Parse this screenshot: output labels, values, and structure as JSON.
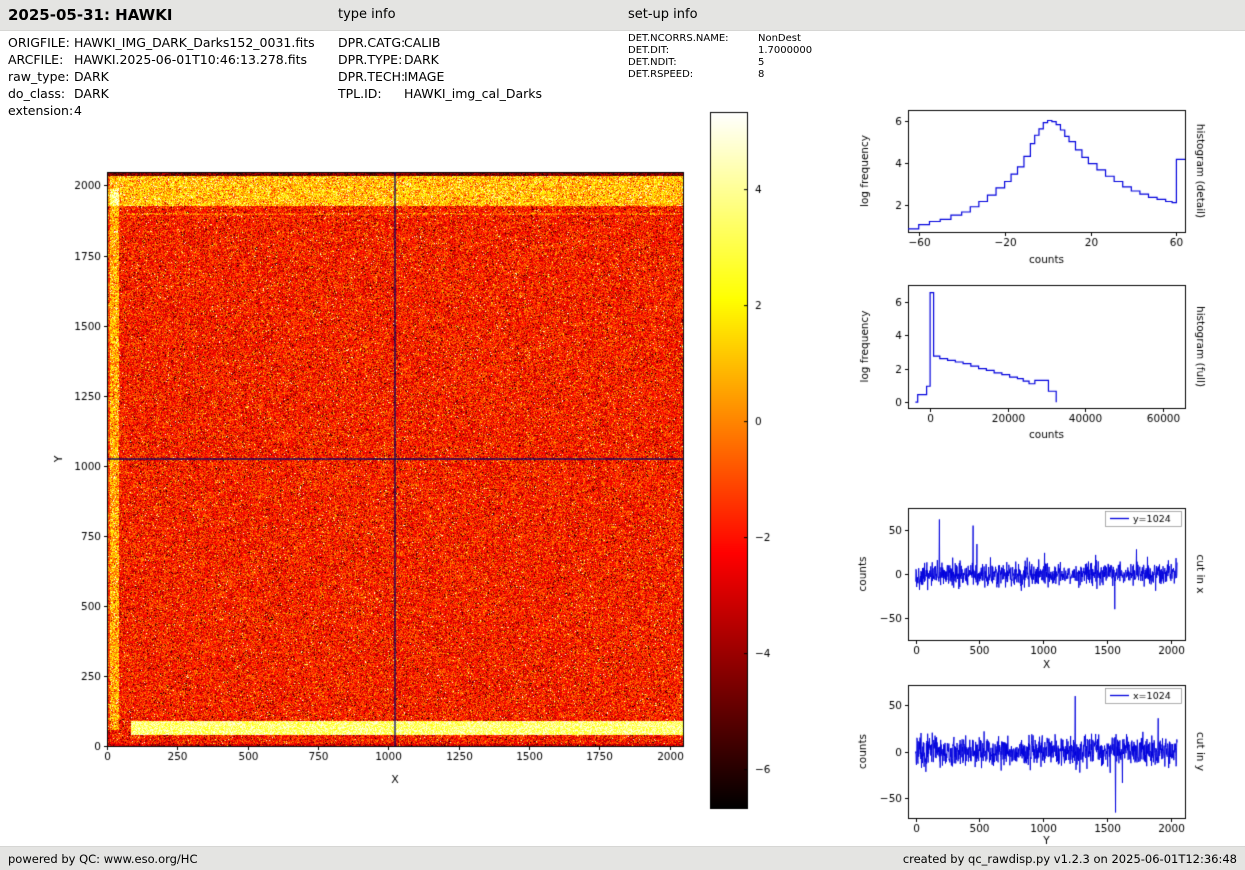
{
  "header": {
    "title": "2025-05-31: HAWKI",
    "type_info_label": "type info",
    "setup_info_label": "set-up info"
  },
  "metadata": {
    "file_info": [
      {
        "label": "ORIGFILE:",
        "value": "HAWKI_IMG_DARK_Darks152_0031.fits"
      },
      {
        "label": "ARCFILE:",
        "value": "HAWKI.2025-06-01T10:46:13.278.fits"
      },
      {
        "label": "raw_type:",
        "value": "DARK"
      },
      {
        "label": "do_class:",
        "value": "DARK"
      },
      {
        "label": "extension:",
        "value": "4"
      }
    ],
    "type_info": [
      {
        "label": "DPR.CATG:",
        "value": "CALIB"
      },
      {
        "label": "DPR.TYPE:",
        "value": "DARK"
      },
      {
        "label": "DPR.TECH:",
        "value": "IMAGE"
      },
      {
        "label": "TPL.ID:",
        "value": "HAWKI_img_cal_Darks"
      }
    ],
    "setup_info": [
      {
        "label": "DET.NCORRS.NAME:",
        "value": "NonDest"
      },
      {
        "label": "DET.DIT:",
        "value": "1.7000000"
      },
      {
        "label": "DET.NDIT:",
        "value": "5"
      },
      {
        "label": "DET.RSPEED:",
        "value": "8"
      }
    ]
  },
  "footer": {
    "left": "powered by QC: www.eso.org/HC",
    "right": "created by qc_rawdisp.py v1.2.3 on 2025-06-01T12:36:48"
  },
  "colors": {
    "plot_line": "#0000dd",
    "crosshair": "#000066",
    "bar_background": "#e4e4e2",
    "colormap": "hot"
  },
  "chart_data": [
    {
      "id": "detector_image",
      "type": "heatmap",
      "xlabel": "X",
      "ylabel": "Y",
      "xlim": [
        0,
        2048
      ],
      "ylim": [
        0,
        2048
      ],
      "xticks": [
        0,
        250,
        500,
        750,
        1000,
        1250,
        1500,
        1750,
        2000
      ],
      "yticks": [
        0,
        250,
        500,
        750,
        1000,
        1250,
        1500,
        1750,
        2000
      ],
      "colormap": "hot",
      "crosshair": {
        "x": 1024,
        "y": 1024
      },
      "colorbar": {
        "vmin": -6.67,
        "vmax": 5.33,
        "ticks": [
          4,
          2,
          0,
          -2,
          -4,
          -6
        ]
      },
      "description": "2048x2048 raw dark frame, hot-colormap noise with bright band near y=70, bright rim near y=1960 and bright left edge, dark-blue crosshair at x=1024 / y=1024"
    },
    {
      "id": "histogram_detail",
      "type": "line",
      "style": "step",
      "xlabel": "counts",
      "ylabel": "log frequency",
      "right_label": "histogram (detail)",
      "xlim": [
        -65,
        64
      ],
      "ylim": [
        0.7,
        6.5
      ],
      "xticks": [
        -60,
        -20,
        20,
        60
      ],
      "yticks": [
        2,
        4,
        6
      ],
      "points": [
        [
          -65,
          0.85
        ],
        [
          -60,
          1.05
        ],
        [
          -55,
          1.2
        ],
        [
          -50,
          1.3
        ],
        [
          -45,
          1.5
        ],
        [
          -40,
          1.65
        ],
        [
          -36,
          1.9
        ],
        [
          -32,
          2.15
        ],
        [
          -28,
          2.45
        ],
        [
          -24,
          2.8
        ],
        [
          -20,
          3.1
        ],
        [
          -17,
          3.45
        ],
        [
          -14,
          3.8
        ],
        [
          -11,
          4.3
        ],
        [
          -8,
          4.9
        ],
        [
          -6,
          5.3
        ],
        [
          -4,
          5.6
        ],
        [
          -2,
          5.9
        ],
        [
          0,
          6.0
        ],
        [
          2,
          5.95
        ],
        [
          4,
          5.8
        ],
        [
          6,
          5.55
        ],
        [
          8,
          5.25
        ],
        [
          10,
          5.0
        ],
        [
          13,
          4.6
        ],
        [
          16,
          4.25
        ],
        [
          19,
          3.95
        ],
        [
          23,
          3.65
        ],
        [
          27,
          3.35
        ],
        [
          31,
          3.1
        ],
        [
          35,
          2.85
        ],
        [
          39,
          2.65
        ],
        [
          43,
          2.5
        ],
        [
          47,
          2.35
        ],
        [
          51,
          2.25
        ],
        [
          55,
          2.15
        ],
        [
          58,
          2.1
        ],
        [
          60,
          4.15
        ],
        [
          64,
          4.15
        ]
      ]
    },
    {
      "id": "histogram_full",
      "type": "line",
      "style": "step",
      "xlabel": "counts",
      "ylabel": "log frequency",
      "right_label": "histogram (full)",
      "xlim": [
        -5700,
        65700
      ],
      "ylim": [
        -0.35,
        7.0
      ],
      "xticks": [
        0,
        20000,
        40000,
        60000
      ],
      "yticks": [
        0,
        2,
        4,
        6
      ],
      "points": [
        [
          -3800,
          0
        ],
        [
          -3200,
          0.45
        ],
        [
          -1800,
          0.45
        ],
        [
          -900,
          0.95
        ],
        [
          -200,
          0.95
        ],
        [
          0,
          6.55
        ],
        [
          900,
          2.75
        ],
        [
          2500,
          2.6
        ],
        [
          4500,
          2.5
        ],
        [
          6500,
          2.4
        ],
        [
          8500,
          2.3
        ],
        [
          10500,
          2.15
        ],
        [
          12500,
          2.0
        ],
        [
          14500,
          1.9
        ],
        [
          16500,
          1.75
        ],
        [
          18500,
          1.65
        ],
        [
          20500,
          1.5
        ],
        [
          22500,
          1.4
        ],
        [
          24000,
          1.25
        ],
        [
          25500,
          1.1
        ],
        [
          27000,
          1.3
        ],
        [
          29500,
          1.3
        ],
        [
          30500,
          0.65
        ],
        [
          31800,
          0.65
        ],
        [
          32500,
          0
        ]
      ]
    },
    {
      "id": "cut_in_x",
      "type": "line",
      "legend": "y=1024",
      "xlabel": "X",
      "ylabel": "counts",
      "right_label": "cut in x",
      "xlim": [
        -60,
        2110
      ],
      "ylim": [
        -75,
        75
      ],
      "x_range": [
        0,
        2048
      ],
      "xticks": [
        0,
        500,
        1000,
        1500,
        2000
      ],
      "yticks": [
        -50,
        0,
        50
      ],
      "noise_std": 6.5,
      "seed": 12,
      "spikes": [
        {
          "x": 30,
          "y": -18
        },
        {
          "x": 185,
          "y": 62
        },
        {
          "x": 450,
          "y": 55
        },
        {
          "x": 480,
          "y": 34
        },
        {
          "x": 1010,
          "y": 24
        },
        {
          "x": 1560,
          "y": -40
        },
        {
          "x": 1730,
          "y": 28
        },
        {
          "x": 2040,
          "y": 18
        }
      ]
    },
    {
      "id": "cut_in_y",
      "type": "line",
      "legend": "x=1024",
      "xlabel": "Y",
      "ylabel": "counts",
      "right_label": "cut in y",
      "xlim": [
        -60,
        2110
      ],
      "ylim": [
        -72,
        72
      ],
      "x_range": [
        0,
        2048
      ],
      "xticks": [
        0,
        500,
        1000,
        1500,
        2000
      ],
      "yticks": [
        -50,
        0,
        50
      ],
      "noise_std": 8,
      "seed": 34,
      "spikes": [
        {
          "x": 80,
          "y": -22
        },
        {
          "x": 1250,
          "y": 60
        },
        {
          "x": 1565,
          "y": -66
        },
        {
          "x": 1620,
          "y": -34
        },
        {
          "x": 1900,
          "y": 36
        },
        {
          "x": 2040,
          "y": -16
        }
      ]
    }
  ]
}
